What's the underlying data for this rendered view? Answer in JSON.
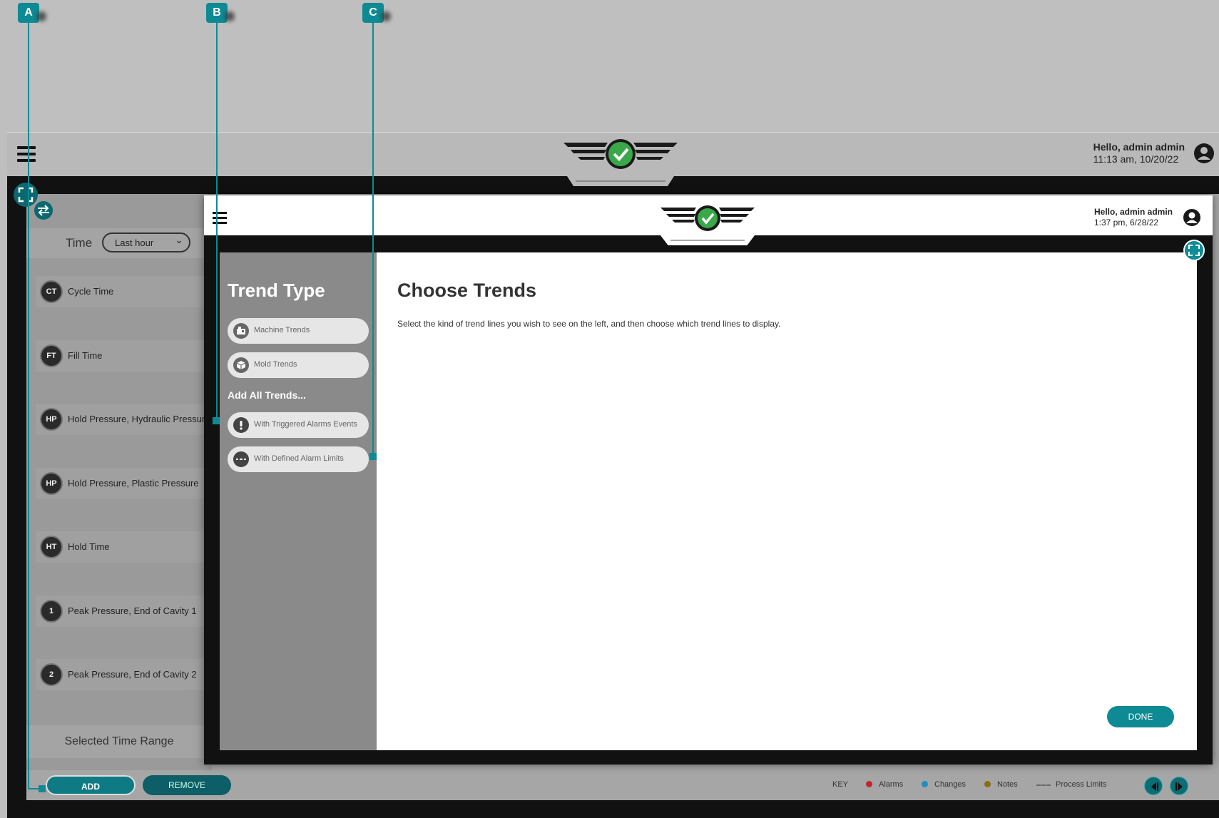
{
  "background_app": {
    "greeting": "Hello, admin admin",
    "datetime": "11:13 am, 10/20/22",
    "time_label": "Time",
    "time_select_value": "Last hour",
    "trend_items": [
      {
        "badge": "CT",
        "label": "Cycle Time"
      },
      {
        "badge": "FT",
        "label": "Fill Time"
      },
      {
        "badge": "HP",
        "label": "Hold Pressure, Hydraulic Pressure"
      },
      {
        "badge": "HP",
        "label": "Hold Pressure, Plastic Pressure"
      },
      {
        "badge": "HT",
        "label": "Hold Time"
      },
      {
        "badge": "1",
        "label": "Peak Pressure, End of Cavity 1"
      },
      {
        "badge": "2",
        "label": "Peak Pressure, End of Cavity 2"
      }
    ],
    "selected_time_range": "Selected Time Range",
    "add_label": "ADD",
    "remove_label": "REMOVE",
    "key": {
      "key_label": "KEY",
      "alarms": "Alarms",
      "changes": "Changes",
      "notes": "Notes",
      "process_limits": "Process Limits"
    }
  },
  "modal": {
    "greeting": "Hello, admin admin",
    "datetime": "1:37 pm, 6/28/22",
    "side_title": "Trend Type",
    "trend_types": [
      {
        "label": "Machine Trends",
        "icon": "machine-icon"
      },
      {
        "label": "Mold Trends",
        "icon": "mold-icon"
      }
    ],
    "add_all_label": "Add All Trends...",
    "add_all_options": [
      {
        "label": "With Triggered Alarms Events",
        "icon": "alert-icon"
      },
      {
        "label": "With Defined Alarm Limits",
        "icon": "dashed-line-icon"
      }
    ],
    "main_title": "Choose Trends",
    "main_description": "Select the kind of trend lines you wish to see on the left, and then choose which trend lines to display.",
    "done_label": "DONE"
  },
  "callouts": {
    "a": "A",
    "b": "B",
    "c": "C"
  },
  "colors": {
    "accent": "#0e8a94",
    "logo_green": "#3aa84a",
    "alarm": "#c0262d",
    "change": "#1c8fc4",
    "note": "#8a6d10"
  }
}
